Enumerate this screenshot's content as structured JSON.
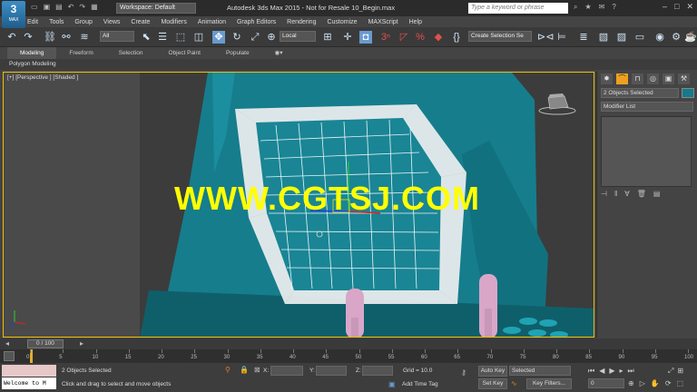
{
  "app": {
    "max_button_label": "MAX",
    "workspace": "Workspace: Default",
    "title": "Autodesk 3ds Max  2015  - Not for Resale   10_Begin.max",
    "search_placeholder": "Type a keyword or phrase"
  },
  "menu": [
    "Edit",
    "Tools",
    "Group",
    "Views",
    "Create",
    "Modifiers",
    "Animation",
    "Graph Editors",
    "Rendering",
    "Customize",
    "MAXScript",
    "Help"
  ],
  "toolbar": {
    "selection_filter": "All",
    "coord_system": "Local",
    "named_selection": "Create Selection Se"
  },
  "ribbon": {
    "tabs": [
      "Modeling",
      "Freeform",
      "Selection",
      "Object Paint",
      "Populate"
    ],
    "active_tab": "Modeling",
    "panel_label": "Polygon Modeling"
  },
  "viewport": {
    "label": "[+] [Perspective ] [Shaded ]",
    "watermark": "WWW.CGTSJ.COM"
  },
  "command_panel": {
    "selection_name": "2 Objects Selected",
    "modifier_list": "Modifier List",
    "color_swatch": "#157a8a"
  },
  "timeline": {
    "frame_display": "0 / 100",
    "ticks": [
      "0",
      "5",
      "10",
      "15",
      "20",
      "25",
      "30",
      "35",
      "40",
      "45",
      "50",
      "55",
      "60",
      "65",
      "70",
      "75",
      "80",
      "85",
      "90",
      "95",
      "100"
    ]
  },
  "status": {
    "welcome": "Welcome to M",
    "selection": "2 Objects Selected",
    "prompt": "Click and drag to select and move objects",
    "x_label": "X:",
    "y_label": "Y:",
    "z_label": "Z:",
    "grid": "Grid = 10.0",
    "add_time_tag": "Add Time Tag",
    "auto_key": "Auto Key",
    "set_key": "Set Key",
    "key_mode": "Selected",
    "key_filters": "Key Filters...",
    "current_frame": "0"
  }
}
